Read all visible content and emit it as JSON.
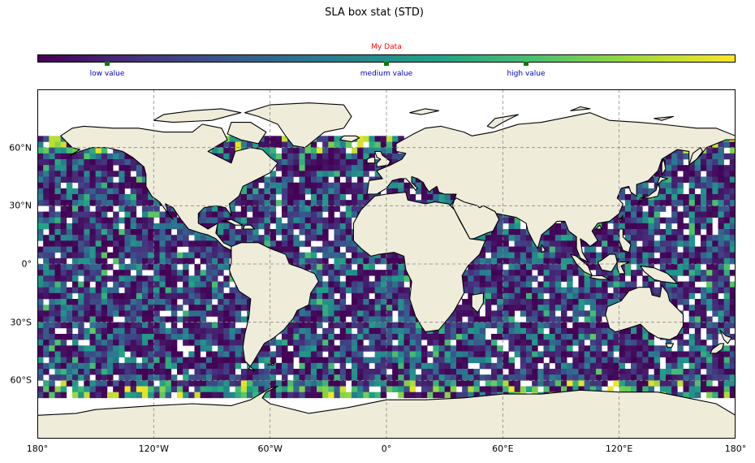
{
  "title": "SLA box stat (STD)",
  "colorbar": {
    "title": "My Data",
    "colormap": "viridis",
    "stops": [
      "#440154",
      "#46327e",
      "#365c8d",
      "#277f8e",
      "#1fa187",
      "#4ac16d",
      "#a0da39",
      "#fde725"
    ],
    "markers": [
      {
        "label": "low value",
        "position": 0.1
      },
      {
        "label": "medium value",
        "position": 0.5
      },
      {
        "label": "high value",
        "position": 0.7
      }
    ]
  },
  "map": {
    "projection": "PlateCarree",
    "extent": {
      "lon_min": -180,
      "lon_max": 180,
      "lat_min": -90,
      "lat_max": 90
    },
    "ocean_grid_color": "#888888",
    "land_color": "#efedda",
    "coast_color": "#000000",
    "no_data_color": "#ffffff",
    "lon_ticks": [
      {
        "value": -180,
        "label": "180°"
      },
      {
        "value": -120,
        "label": "120°W"
      },
      {
        "value": -60,
        "label": "60°W"
      },
      {
        "value": 0,
        "label": "0°"
      },
      {
        "value": 60,
        "label": "60°E"
      },
      {
        "value": 120,
        "label": "120°E"
      },
      {
        "value": 180,
        "label": "180°"
      }
    ],
    "lat_ticks": [
      {
        "value": 60,
        "label": "60°N"
      },
      {
        "value": 30,
        "label": "30°N"
      },
      {
        "value": 0,
        "label": "0°"
      },
      {
        "value": -30,
        "label": "30°S"
      },
      {
        "value": -60,
        "label": "60°S"
      }
    ],
    "data_lat_range": [
      -68,
      66
    ],
    "cell_size_deg": 3
  }
}
